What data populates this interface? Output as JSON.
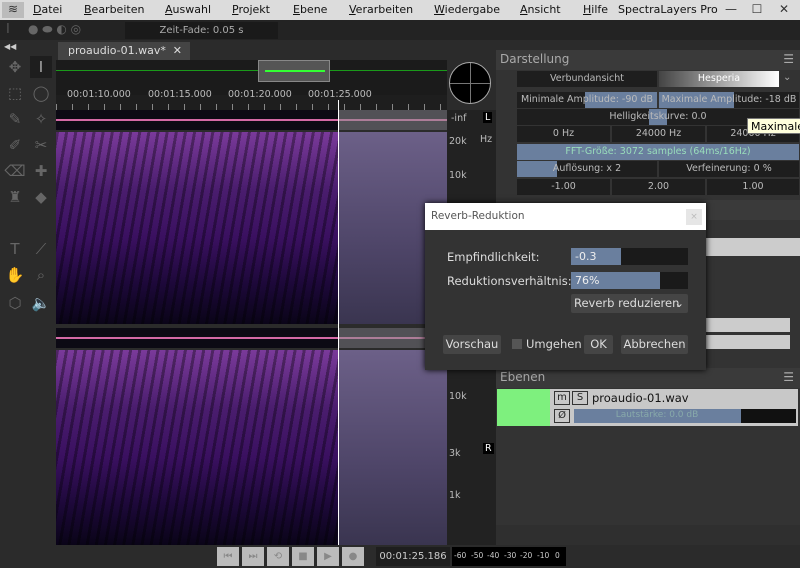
{
  "menu": {
    "items": [
      "Datei",
      "Bearbeiten",
      "Auswahl",
      "Projekt",
      "Ebene",
      "Verarbeiten",
      "Wiedergabe",
      "Ansicht",
      "Hilfe"
    ],
    "app_name": "SpectraLayers Pro"
  },
  "toolbar": {
    "fade_label": "Zeit-Fade: 0.05 s"
  },
  "tab": {
    "label": "proaudio-01.wav*",
    "close": "✕"
  },
  "ruler": {
    "ticks": [
      "00:01:10.000",
      "00:01:15.000",
      "00:01:20.000",
      "00:01:25.000"
    ]
  },
  "channels": {
    "level": "-inf",
    "left": "L",
    "right": "R"
  },
  "freq": {
    "unit": "Hz",
    "top": [
      "20k",
      "10k"
    ],
    "bottom": [
      "10k",
      "3k",
      "1k"
    ]
  },
  "darstellung": {
    "title": "Darstellung",
    "view": "Verbundansicht",
    "palette": "Hesperia",
    "min_amp": "Minimale Amplitude: -90 dB",
    "max_amp": "Maximale Amplitude: -18 dB",
    "curve": "Helligkeitskurve: 0.0",
    "freq_min": "0  Hz",
    "freq_max": "24000  Hz",
    "freq_3": "24000  Hz",
    "fft": "FFT-Größe: 3072 samples (64ms/16Hz)",
    "resolution": "Auflösung: x 2",
    "refine": "Verfeinerung: 0 %",
    "v1": "-1.00",
    "v2": "2.00",
    "v3": "1.00"
  },
  "tooltip": "Maximale",
  "dialog": {
    "title": "Reverb-Reduktion",
    "close": "×",
    "sens_label": "Empfindlichkeit:",
    "sens_value": "-0.3",
    "sens_fraction": 0.43,
    "ratio_label": "Reduktionsverhältnis:",
    "ratio_value": "76%",
    "ratio_fraction": 0.76,
    "mode": "Reverb reduzieren",
    "preview": "Vorschau",
    "bypass": "Umgehen",
    "ok": "OK",
    "cancel": "Abbrechen"
  },
  "layers": {
    "title": "Ebenen",
    "name": "proaudio-01.wav",
    "m": "m",
    "s": "S",
    "phase": "Ø",
    "volume": "Lautstärke: 0.0 dB",
    "volume_fraction": 0.75
  },
  "transport": {
    "time": "00:01:25.186",
    "meter_ticks": [
      "-60",
      "-50",
      "-40",
      "-30",
      "-20",
      "-10",
      "0"
    ]
  },
  "colors": {
    "accent": "#6a7f9e",
    "waveform": "#d46aa6",
    "layer": "#7ef07e"
  }
}
